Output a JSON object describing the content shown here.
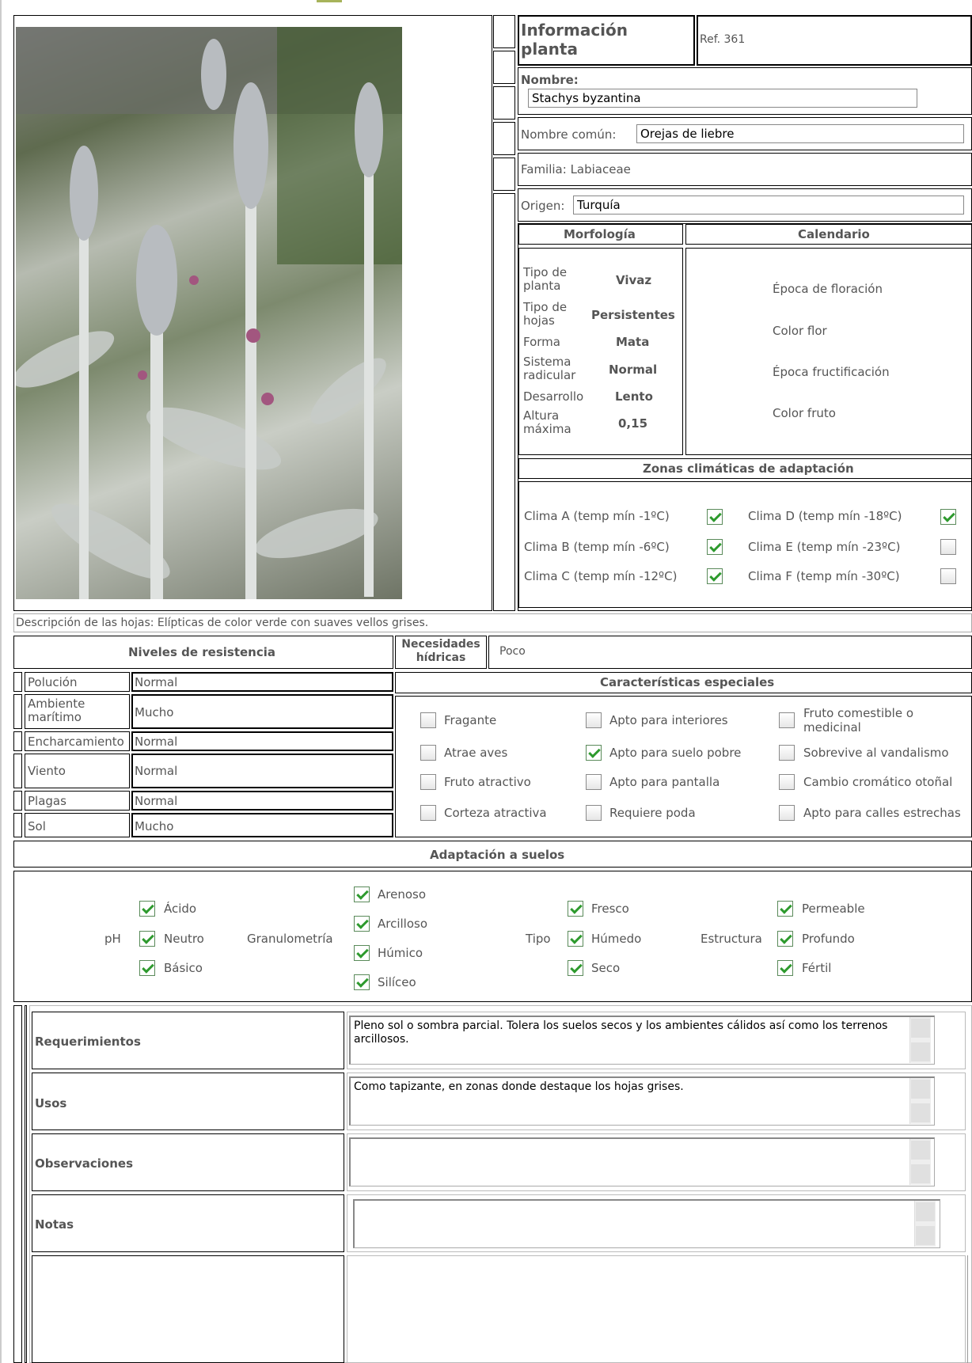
{
  "header": {
    "title": "Información planta",
    "ref": "Ref. 361"
  },
  "plant": {
    "name_label": "Nombre:",
    "name": "Stachys byzantina",
    "common_label": "Nombre común:",
    "common": "Orejas de liebre",
    "family": "Familia:  Labiaceae",
    "origin_label": "Origen:",
    "origin": "Turquía"
  },
  "morph": {
    "title": "Morfología",
    "rows": [
      {
        "label": "Tipo de planta",
        "value": "Vivaz"
      },
      {
        "label": "Tipo de hojas",
        "value": "Persistentes"
      },
      {
        "label": "Forma",
        "value": "Mata"
      },
      {
        "label": "Sistema radicular",
        "value": "Normal"
      },
      {
        "label": "Desarrollo",
        "value": "Lento"
      },
      {
        "label": "Altura máxima",
        "value": "0,15"
      }
    ]
  },
  "calendar": {
    "title": "Calendario",
    "items": [
      "Época de floración",
      "Color flor",
      "Época fructificación",
      "Color fruto"
    ]
  },
  "climate": {
    "title": "Zonas climáticas de adaptación",
    "zones": [
      {
        "label": "Clima A (temp mín -1ºC)",
        "checked": true
      },
      {
        "label": "Clima B (temp mín -6ºC)",
        "checked": true
      },
      {
        "label": "Clima C (temp mín -12ºC)",
        "checked": true
      },
      {
        "label": "Clima D (temp mín -18ºC)",
        "checked": true
      },
      {
        "label": "Clima E (temp mín -23ºC)",
        "checked": false
      },
      {
        "label": "Clima F (temp mín -30ºC)",
        "checked": false
      }
    ]
  },
  "leaves": "Descripción de las hojas:  Elípticas de color verde con suaves vellos grises.",
  "resistance": {
    "title": "Niveles de resistencia",
    "rows": [
      {
        "label": "Polución",
        "value": "Normal"
      },
      {
        "label": "Ambiente marítimo",
        "value": "Mucho"
      },
      {
        "label": "Encharcamiento",
        "value": "Normal"
      },
      {
        "label": "Viento",
        "value": "Normal"
      },
      {
        "label": "Plagas",
        "value": "Normal"
      },
      {
        "label": "Sol",
        "value": "Mucho"
      }
    ]
  },
  "water": {
    "label": "Necesidades hídricas",
    "value": "Poco"
  },
  "special": {
    "title": "Características especiales",
    "items": [
      {
        "label": "Fragante",
        "checked": false
      },
      {
        "label": "Apto para interiores",
        "checked": false
      },
      {
        "label": "Fruto comestible o medicinal",
        "checked": false
      },
      {
        "label": "Atrae aves",
        "checked": false
      },
      {
        "label": "Apto para suelo pobre",
        "checked": true
      },
      {
        "label": "Sobrevive al vandalismo",
        "checked": false
      },
      {
        "label": "Fruto atractivo",
        "checked": false
      },
      {
        "label": "Apto para pantalla",
        "checked": false
      },
      {
        "label": "Cambio cromático otoñal",
        "checked": false
      },
      {
        "label": "Corteza atractiva",
        "checked": false
      },
      {
        "label": "Requiere poda",
        "checked": false
      },
      {
        "label": "Apto para calles estrechas",
        "checked": false
      }
    ]
  },
  "soil": {
    "title": "Adaptación a suelos",
    "ph_label": "pH",
    "ph": [
      "Ácido",
      "Neutro",
      "Básico"
    ],
    "gran_label": "Granulometría",
    "gran": [
      "Arenoso",
      "Arcilloso",
      "Húmico",
      "Silíceo"
    ],
    "tipo_label": "Tipo",
    "tipo": [
      "Fresco",
      "Húmedo",
      "Seco"
    ],
    "est_label": "Estructura",
    "est": [
      "Permeable",
      "Profundo",
      "Fértil"
    ]
  },
  "notes": {
    "req_label": "Requerimientos",
    "req": "Pleno sol o sombra parcial. Tolera los suelos secos y los ambientes cálidos así como  los terrenos arcillosos.",
    "usos_label": "Usos",
    "usos": "Como tapizante, en zonas donde destaque los hojas grises.",
    "obs_label": "Observaciones",
    "obs": "",
    "notas_label": "Notas",
    "notas": ""
  }
}
